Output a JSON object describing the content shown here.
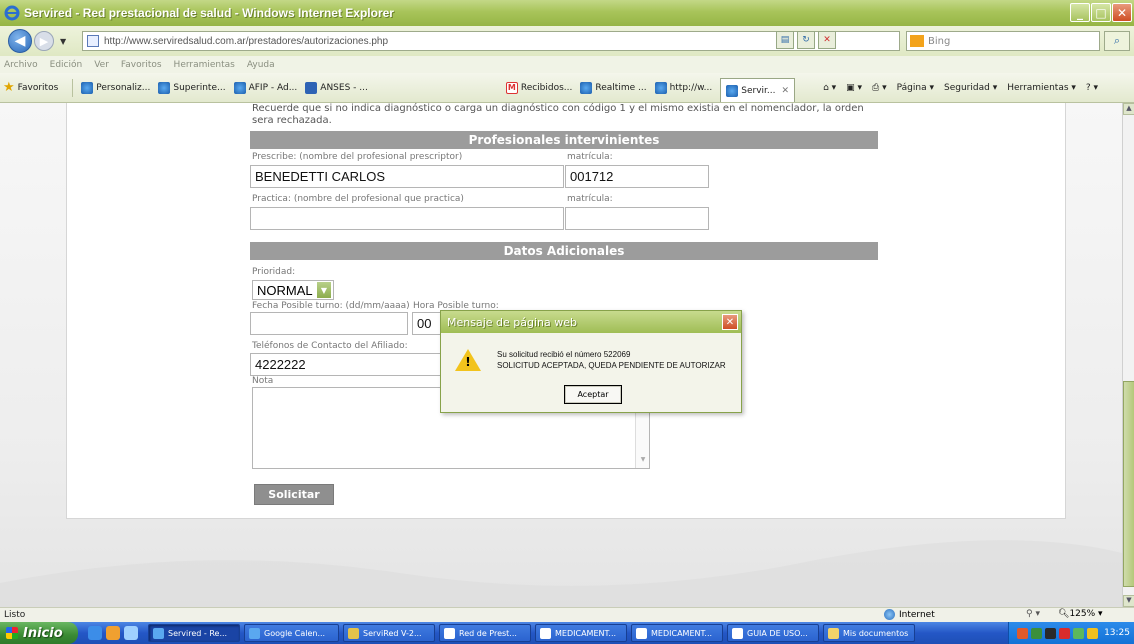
{
  "window": {
    "title": "Servired - Red prestacional de salud - Windows Internet Explorer"
  },
  "address": {
    "url": "http://www.serviredsalud.com.ar/prestadores/autorizaciones.php",
    "search_placeholder": "Bing"
  },
  "menu": [
    "Archivo",
    "Edición",
    "Ver",
    "Favoritos",
    "Herramientas",
    "Ayuda"
  ],
  "favorites": {
    "label": "Favoritos",
    "items": [
      "Personaliz...",
      "Superinte...",
      "AFIP - Ad...",
      "ANSES - ..."
    ],
    "tabs": [
      "Recibidos...",
      "Realtime ...",
      "http://w...",
      "Servir..."
    ]
  },
  "commands": [
    "Página",
    "Seguridad",
    "Herramientas"
  ],
  "page": {
    "notice": "Recuerde que si no indica diagnóstico o carga un diagnóstico con código 1 y el mismo existia en el nomenclador, la orden sera rechazada.",
    "section_profesionales": "Profesionales intervinientes",
    "prescribe_label": "Prescribe: (nombre del profesional prescriptor)",
    "prescribe_value": "BENEDETTI CARLOS",
    "matricula_label": "matrícula:",
    "matricula_value": "001712",
    "practica_label": "Practica: (nombre del profesional que practica)",
    "matricula2_label": "matrícula:",
    "matricula2_value": "",
    "practica_value": "",
    "section_adicionales": "Datos Adicionales",
    "prioridad_label": "Prioridad:",
    "prioridad_value": "NORMAL",
    "fecha_label": "Fecha Posible turno: (dd/mm/aaaa)",
    "hora_label": "Hora Posible turno:",
    "hora_value": "00",
    "telefonos_label": "Teléfonos de Contacto del Afiliado:",
    "telefonos_value": "4222222",
    "nota_label": "Nota",
    "solicitar_label": "Solicitar"
  },
  "dialog": {
    "title": "Mensaje de página web",
    "line1": "Su solicitud recibió el número 522069",
    "line2": "SOLICITUD ACEPTADA, QUEDA PENDIENTE DE AUTORIZAR",
    "ok_label": "Aceptar"
  },
  "status": {
    "text": "Listo",
    "zone": "Internet",
    "zoom": "125%"
  },
  "taskbar": {
    "start_label": "Inicio",
    "tasks": [
      "Servired - Re...",
      "Google Calen...",
      "ServiRed V-2...",
      "Red de Prest...",
      "MEDICAMENT...",
      "MEDICAMENT...",
      "GUIA DE USO...",
      "Mis documentos"
    ],
    "clock": "13:25"
  }
}
